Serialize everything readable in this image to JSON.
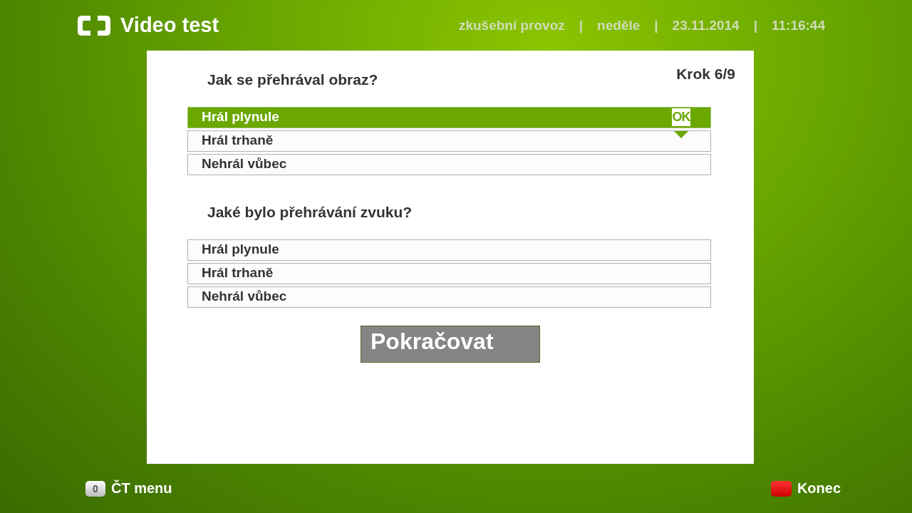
{
  "header": {
    "title": "Video test",
    "status": [
      {
        "text": "zkušební provoz"
      },
      {
        "text": "neděle"
      },
      {
        "text": "23.11.2014"
      },
      {
        "text": "11:16:44"
      }
    ],
    "separator": "|"
  },
  "step": "Krok 6/9",
  "questions": [
    {
      "text": "Jak se přehrával obraz?",
      "options": [
        {
          "label": "Hrál plynule",
          "selected": true
        },
        {
          "label": "Hrál trhaně",
          "selected": false
        },
        {
          "label": "Nehrál vůbec",
          "selected": false
        }
      ]
    },
    {
      "text": "Jaké bylo přehrávání zvuku?",
      "options": [
        {
          "label": "Hrál plynule",
          "selected": false
        },
        {
          "label": "Hrál trhaně",
          "selected": false
        },
        {
          "label": "Nehrál vůbec",
          "selected": false
        }
      ]
    }
  ],
  "ok_badge": "OK",
  "continue_button": "Pokračovat",
  "footer": {
    "left": {
      "key": "0",
      "label": "ČT menu"
    },
    "right": {
      "label": "Konec"
    }
  }
}
